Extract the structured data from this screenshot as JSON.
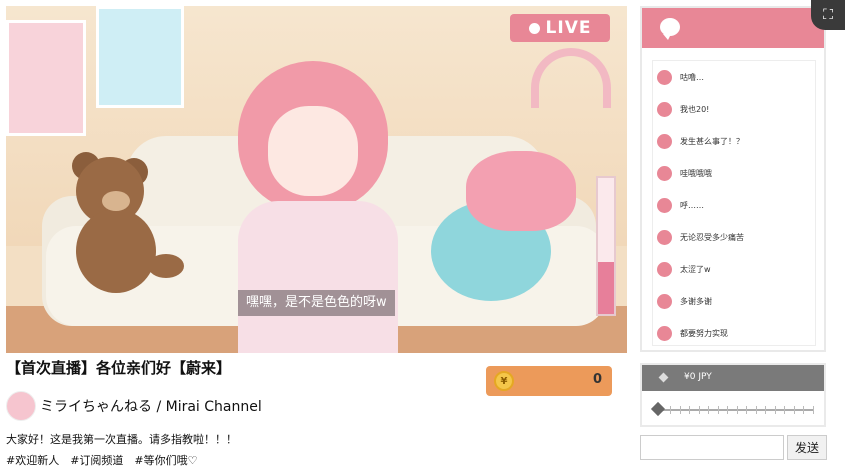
{
  "stream": {
    "live_label": "LIVE",
    "subtitle": "嘿嘿，是不是色色的呀w",
    "audio_level": 0.38
  },
  "chat": {
    "icon": "chat-bubble-icon",
    "accent": "#e88796",
    "messages": [
      "咕噜…",
      "我也20!",
      "发生甚么事了！？",
      "哇哦哦哦",
      "呼……",
      "无论忍受多少痛苦",
      "太涩了w",
      "多谢多谢",
      "都要努力实现"
    ]
  },
  "expand": {
    "icon": "fullscreen-icon"
  },
  "info": {
    "title": "【首次直播】各位亲们好【蔚来】",
    "channel_name": "ミライちゃんねる / Mirai Channel",
    "description": "大家好！这是我第一次直播。请多指教啦！！！",
    "tags": "#欢迎新人　#订阅频道　#等你们哦♡"
  },
  "coins": {
    "symbol": "¥",
    "value": "0",
    "color": "#ec9a5a"
  },
  "donate": {
    "amount_label": "¥0 JPY",
    "slider_value": 0
  },
  "input": {
    "placeholder": "",
    "send_label": "发送"
  }
}
